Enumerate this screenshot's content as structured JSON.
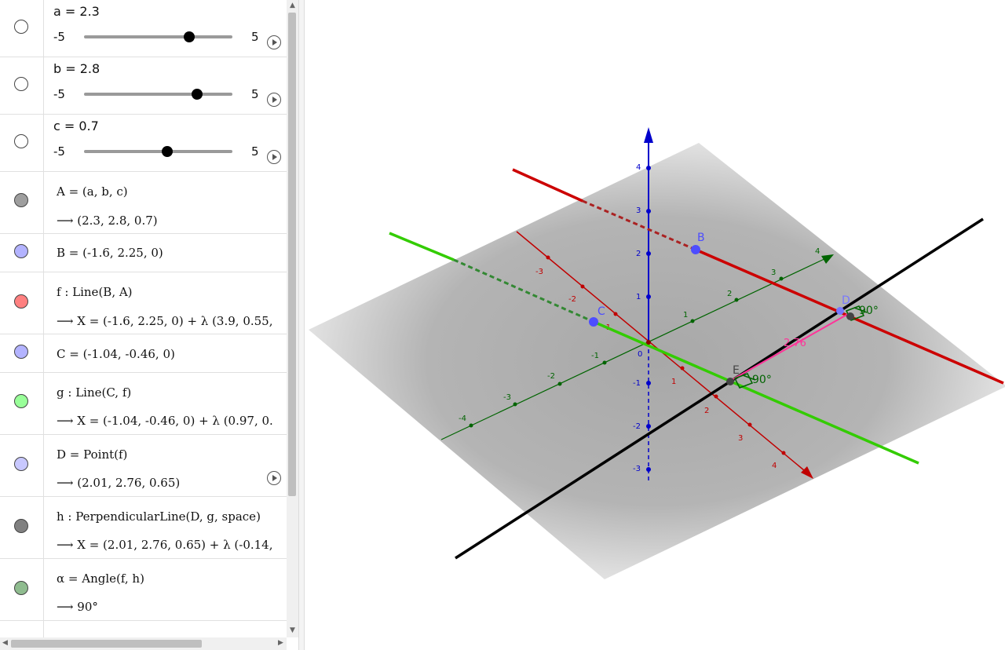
{
  "sliders": [
    {
      "label": "a = 2.3",
      "min": "-5",
      "max": "5",
      "value": 2.3,
      "fraction": 0.73
    },
    {
      "label": "b = 2.8",
      "min": "-5",
      "max": "5",
      "value": 2.8,
      "fraction": 0.78
    },
    {
      "label": "c = 0.7",
      "min": "-5",
      "max": "5",
      "value": 0.7,
      "fraction": 0.57
    }
  ],
  "objects": {
    "A": {
      "def": "A  =  (a, b, c)",
      "out": "⟶  (2.3,  2.8,  0.7)",
      "color": "#9e9e9e"
    },
    "B": {
      "def": "B  =  (-1.6,  2.25,  0)",
      "color": "#b3b3ff"
    },
    "f": {
      "def": "f : Line(B, A)",
      "out": "⟶  X  =  (-1.6,  2.25,  0)  +  λ  (3.9,  0.55,",
      "color": "#ff8080"
    },
    "C": {
      "def": "C  =  (-1.04,  -0.46,  0)",
      "color": "#b3b3ff"
    },
    "g": {
      "def": "g : Line(C, f)",
      "out": "⟶  X  =  (-1.04,  -0.46,  0)  +  λ  (0.97,  0.",
      "color": "#99ff99"
    },
    "D": {
      "def": "D  =  Point(f)",
      "out": "⟶  (2.01,  2.76,  0.65)",
      "color": "#c8c8ff"
    },
    "h": {
      "def": "h : PerpendicularLine(D, g, space)",
      "out": "⟶  X  =  (2.01,  2.76,  0.65)  +  λ  (-0.14,",
      "color": "#808080"
    },
    "alpha": {
      "def": "α  =  Angle(f, h)",
      "out": "⟶  90°",
      "color": "#8fbc8f"
    }
  },
  "graphics": {
    "point_labels": {
      "B": "B",
      "C": "C",
      "D": "D",
      "E": "E"
    },
    "angle_labels": [
      "90°",
      "90°"
    ],
    "distance_label": "2.76",
    "z_ticks": [
      "4",
      "3",
      "2",
      "1",
      "0",
      "-1",
      "-2",
      "-3"
    ],
    "x_ticks": [
      "-3",
      "-2",
      "-1",
      "1",
      "2",
      "3",
      "4"
    ],
    "y_ticks": [
      "-4",
      "-3",
      "-2",
      "-1",
      "1",
      "2",
      "3",
      "4"
    ],
    "colors": {
      "x_axis": "#c00000",
      "y_axis": "#006400",
      "z_axis": "#0000cc",
      "line_f": "#cc0000",
      "line_g": "#33cc00",
      "line_h": "#000000",
      "point": "#4d4dff",
      "distance": "#ff3399"
    }
  }
}
